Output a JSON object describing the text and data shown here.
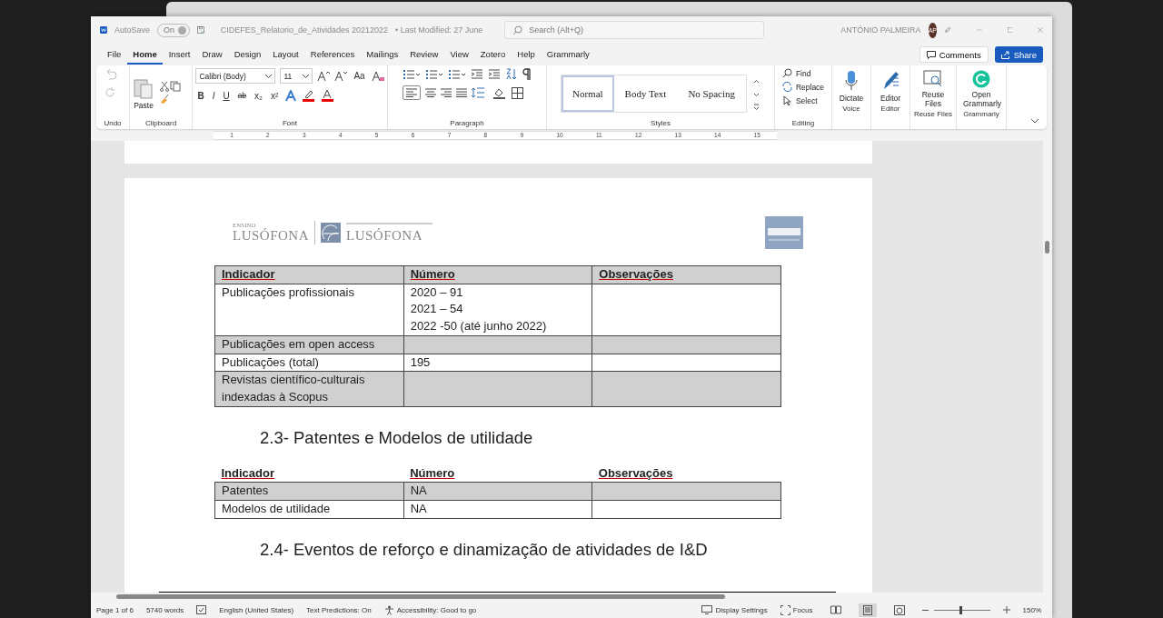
{
  "title_bar": {
    "autosave_label": "AutoSave",
    "autosave": {
      "label": "On",
      "on": true
    },
    "filename": "CIDEFES_Relatorio_de_Atividades 20212022",
    "modified": "• Last Modified: 27 June",
    "search_placeholder": "Search (Alt+Q)",
    "user": "ANTÓNIO PALMEIRA",
    "avatar": "AP"
  },
  "tabs": [
    {
      "label": "File",
      "selected": false
    },
    {
      "label": "Home",
      "selected": true
    },
    {
      "label": "Insert",
      "selected": false
    },
    {
      "label": "Draw",
      "selected": false
    },
    {
      "label": "Design",
      "selected": false
    },
    {
      "label": "Layout",
      "selected": false
    },
    {
      "label": "References",
      "selected": false
    },
    {
      "label": "Mailings",
      "selected": false
    },
    {
      "label": "Review",
      "selected": false
    },
    {
      "label": "View",
      "selected": false
    },
    {
      "label": "Zotero",
      "selected": false
    },
    {
      "label": "Help",
      "selected": false
    },
    {
      "label": "Grammarly",
      "selected": false
    }
  ],
  "comments": "Comments",
  "share": "Share",
  "ribbon": {
    "groups": [
      "Undo",
      "Clipboard",
      "Font",
      "Paragraph",
      "Styles",
      "Editing",
      "Voice",
      "Editor",
      "Reuse Files",
      "Grammarly"
    ],
    "paste": "Paste",
    "font_name": "Calibri (Body)",
    "font_size": "11",
    "case_button": "Aa",
    "format_buttons": [
      "B",
      "I",
      "U",
      "ab",
      "x₂",
      "x²"
    ],
    "styles": [
      {
        "label": "Normal",
        "selected": true
      },
      {
        "label": "Body Text",
        "selected": false
      },
      {
        "label": "No Spacing",
        "selected": false
      }
    ],
    "editing": [
      "Find",
      "Replace",
      "Select"
    ],
    "dictate": "Dictate",
    "editor": "Editor",
    "reuse_files": "Reuse Files",
    "open_grammarly": "Open Grammarly"
  },
  "ruler": [
    "1",
    "2",
    "3",
    "4",
    "5",
    "6",
    "7",
    "8",
    "9",
    "10",
    "11",
    "12",
    "13",
    "14",
    "15"
  ],
  "document": {
    "logos": {
      "left_small": "ENSINO",
      "left_big": "LUSÓFONA",
      "right_big": "LUSÓFONA"
    },
    "table_1": {
      "header_shaded": true,
      "columns": [
        "Indicador",
        "Número",
        "Observações"
      ],
      "rows": [
        {
          "shaded": false,
          "indicator": "Publicações profissionais",
          "number": [
            "2020 – 91",
            "2021 – 54",
            "2022 -50 (até junho 2022)"
          ]
        },
        {
          "shaded": true,
          "indicator": "Publicações em open access"
        },
        {
          "shaded": false,
          "indicator": "Publicações (total)",
          "number": [
            "195"
          ]
        },
        {
          "shaded": true,
          "indicator": "Revistas científico-culturais indexadas à Scopus"
        }
      ]
    },
    "heading_1": "2.3- Patentes e Modelos de utilidade",
    "table_2": {
      "header_shaded": false,
      "columns": [
        "Indicador",
        "Número",
        "Observações"
      ],
      "rows": [
        {
          "shaded": true,
          "indicator": "Patentes",
          "number": [
            "NA"
          ]
        },
        {
          "shaded": false,
          "indicator": "Modelos de utilidade",
          "number": [
            "NA"
          ]
        }
      ]
    },
    "heading_2": "2.4- Eventos de reforço e dinamização de atividades de I&D"
  },
  "status_bar": {
    "page": "Page 1 of 6",
    "words": "5740 words",
    "language": "English (United States)",
    "predictions": "Text Predictions: On",
    "accessibility": "Accessibility: Good to go",
    "display_settings": "Display Settings",
    "focus": "Focus",
    "views": [
      {
        "kind": "read",
        "selected": false
      },
      {
        "kind": "print",
        "selected": true
      },
      {
        "kind": "web",
        "selected": false
      }
    ],
    "zoom": {
      "level": 0.48,
      "reading": "150%"
    }
  }
}
